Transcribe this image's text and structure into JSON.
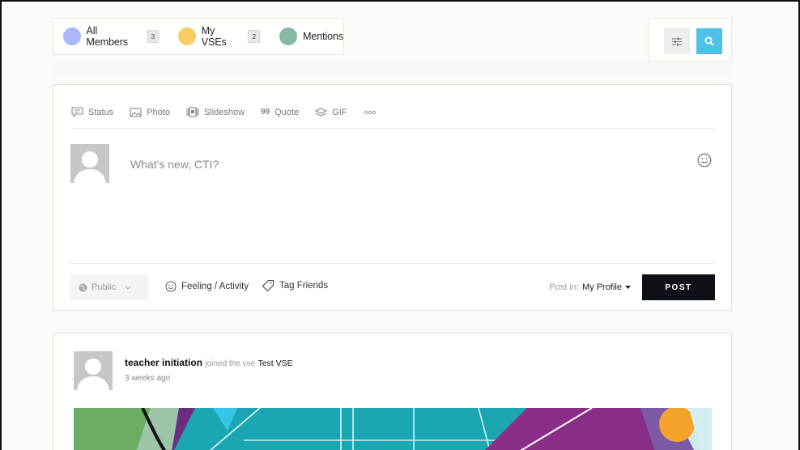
{
  "tabs": [
    {
      "label": "All Members",
      "count": "3",
      "color": "#a9b8f7"
    },
    {
      "label": "My VSEs",
      "count": "2",
      "color": "#f8cd62"
    },
    {
      "label": "Mentions",
      "count": "",
      "color": "#86b8a2"
    }
  ],
  "tools": {
    "filter_icon": "sliders-icon",
    "search_icon": "search-icon",
    "search_color": "#4fc1e9"
  },
  "composer": {
    "post_types": [
      {
        "label": "Status",
        "icon": "status-icon"
      },
      {
        "label": "Photo",
        "icon": "photo-icon"
      },
      {
        "label": "Slideshow",
        "icon": "slideshow-icon"
      },
      {
        "label": "Quote",
        "icon": "quote-icon"
      },
      {
        "label": "GIF",
        "icon": "gif-icon"
      },
      {
        "label": "",
        "icon": "more-icon"
      }
    ],
    "placeholder": "What's new, CTI?",
    "privacy": "Public",
    "feeling": "Feeling / Activity",
    "tag_friends": "Tag Friends",
    "post_in_label": "Post in:",
    "post_in_value": "My Profile",
    "post_button": "POST",
    "quote_glyph": "99"
  },
  "activity": {
    "user": "teacher initiation",
    "action": "joined the vse",
    "target": "Test VSE",
    "time": "3 weeks ago"
  }
}
